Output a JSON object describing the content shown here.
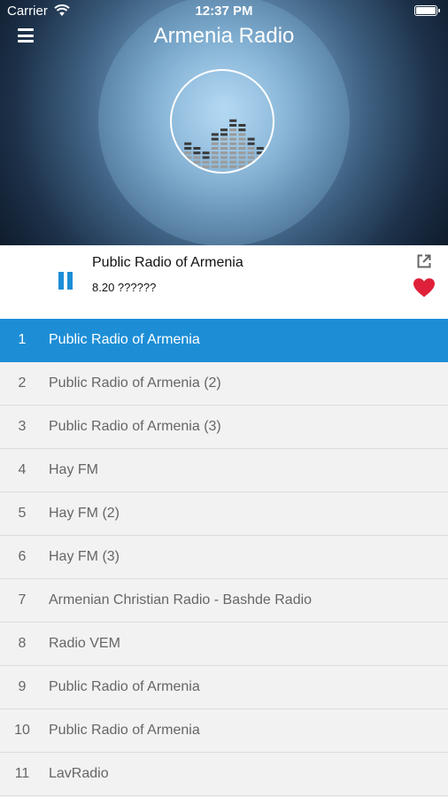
{
  "status_bar": {
    "carrier": "Carrier",
    "time": "12:37 PM"
  },
  "header": {
    "title": "Armenia Radio",
    "menu_icon": "hamburger-menu-icon",
    "logo_icon": "equalizer-logo-icon"
  },
  "player": {
    "station": "Public Radio of Armenia",
    "track": "8.20 ??????",
    "state": "playing",
    "share_icon": "external-link-icon",
    "favorite_icon": "heart-icon",
    "accent_color": "#1d8ed6",
    "favorite_color": "#e0203a"
  },
  "stations": [
    {
      "number": "1",
      "name": "Public Radio of Armenia",
      "active": true
    },
    {
      "number": "2",
      "name": "Public Radio of Armenia (2)"
    },
    {
      "number": "3",
      "name": "Public Radio of Armenia (3)"
    },
    {
      "number": "4",
      "name": "Hay FM"
    },
    {
      "number": "5",
      "name": "Hay FM (2)"
    },
    {
      "number": "6",
      "name": "Hay FM (3)"
    },
    {
      "number": "7",
      "name": "Armenian Christian Radio - Bashde Radio"
    },
    {
      "number": "8",
      "name": "Radio VEM"
    },
    {
      "number": "9",
      "name": "Public Radio of Armenia"
    },
    {
      "number": "10",
      "name": "Public Radio of Armenia"
    },
    {
      "number": "11",
      "name": "LavRadio"
    }
  ]
}
